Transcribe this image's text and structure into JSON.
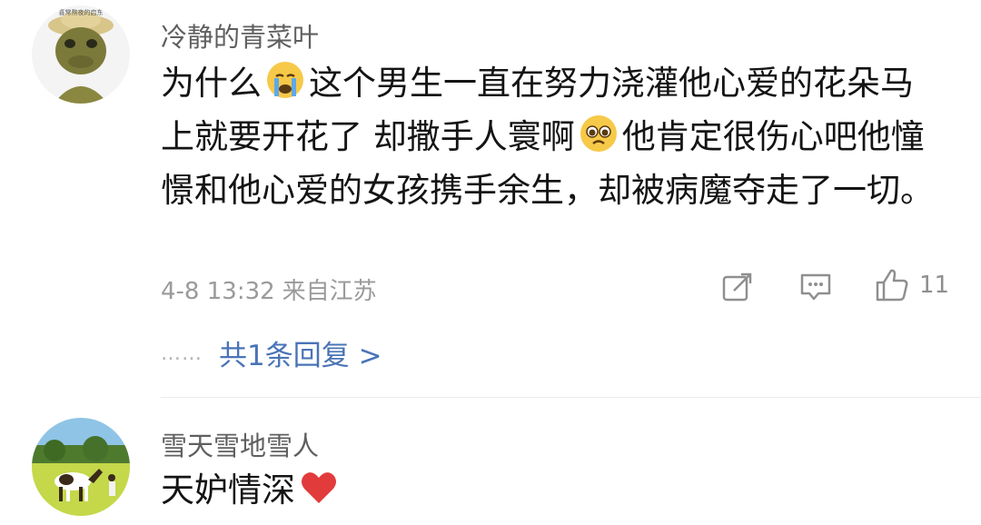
{
  "comments": [
    {
      "username": "冷静的青菜叶",
      "avatar_text": "喜常熬夜的启东",
      "text_part1": "为什么",
      "emoji1": "crying-face-icon",
      "text_part2": "这个男生一直在努力浇灌他心爱的花朵马上就要开花了 却撒手人寰啊",
      "emoji2": "pleading-face-icon",
      "text_part3": "他肯定很伤心吧他憧憬和他心爱的女孩携手余生，却被病魔夺走了一切。",
      "time": "4-8 13:32",
      "location": "来自江苏",
      "like_count": "11",
      "replies_dots": "……",
      "replies_label": "共1条回复 >"
    },
    {
      "username": "雪天雪地雪人",
      "text_part1": "天妒情深",
      "emoji1": "red-heart-icon"
    }
  ],
  "colors": {
    "username": "#5f5f5f",
    "body_text": "#141414",
    "meta": "#9a9a9a",
    "reply_link": "#4a74b8"
  }
}
